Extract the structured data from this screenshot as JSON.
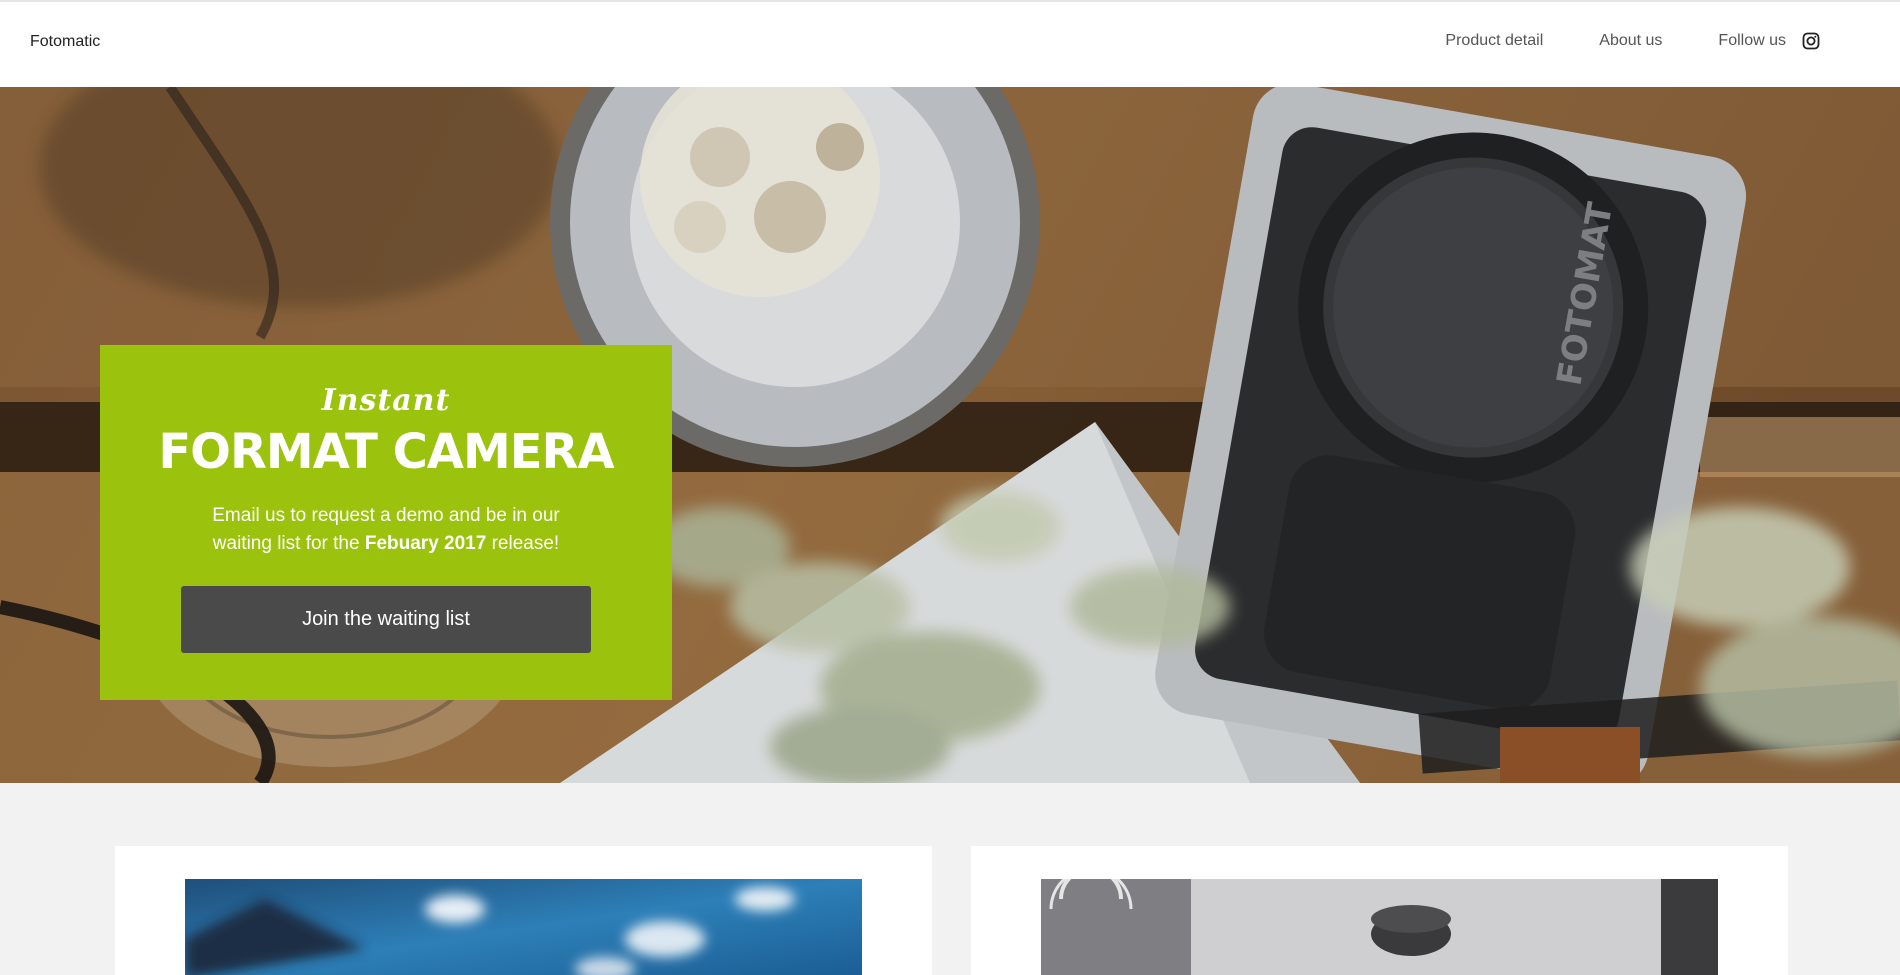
{
  "navbar": {
    "brand": "Fotomatic",
    "links": [
      {
        "label": "Product detail"
      },
      {
        "label": "About us"
      },
      {
        "label": "Follow us"
      }
    ],
    "social_icon": "instagram-icon"
  },
  "hero": {
    "image": "top-down photo of a vintage camera on a wooden table with a bowl, glass, envelope and plant",
    "camera_lens_text": "FOTOMAT",
    "promo": {
      "script_label": "Instant",
      "title": "FORMAT CAMERA",
      "text_before": "Email us to request a demo and be in our waiting list for the ",
      "text_bold": "Febuary 2017",
      "text_after": " release!",
      "button_label": "Join the waiting list"
    }
  },
  "cards": [
    {
      "image": "blue sky with mountains, blurred"
    },
    {
      "image": "close-up of camera details"
    }
  ],
  "colors": {
    "accent": "#9bc20c",
    "button": "#4a4a4a",
    "page_bg": "#f2f2f2"
  }
}
